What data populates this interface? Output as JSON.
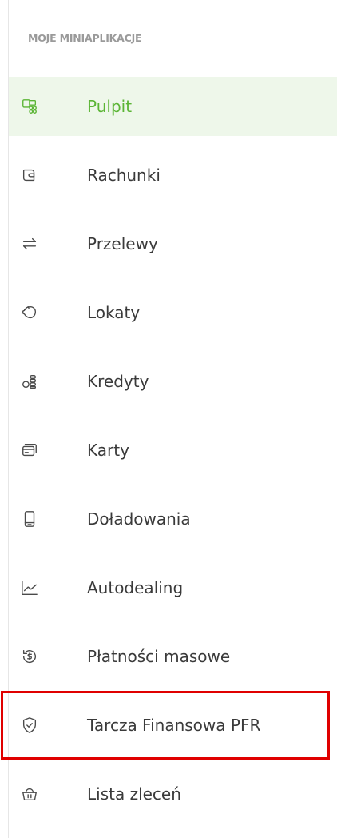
{
  "section_title": "MOJE MINIAPLIKACJE",
  "accent_color": "#5bb535",
  "highlight_color": "#e00000",
  "menu": [
    {
      "label": "Pulpit",
      "icon": "dashboard-icon",
      "active": true
    },
    {
      "label": "Rachunki",
      "icon": "wallet-icon",
      "active": false
    },
    {
      "label": "Przelewy",
      "icon": "transfer-arrows-icon",
      "active": false
    },
    {
      "label": "Lokaty",
      "icon": "piggy-bank-icon",
      "active": false
    },
    {
      "label": "Kredyty",
      "icon": "coins-icon",
      "active": false
    },
    {
      "label": "Karty",
      "icon": "cards-icon",
      "active": false
    },
    {
      "label": "Doładowania",
      "icon": "phone-icon",
      "active": false
    },
    {
      "label": "Autodealing",
      "icon": "line-chart-icon",
      "active": false
    },
    {
      "label": "Płatności masowe",
      "icon": "dollar-cycle-icon",
      "active": false
    },
    {
      "label": "Tarcza Finansowa PFR",
      "icon": "shield-check-icon",
      "active": false,
      "highlighted": true
    },
    {
      "label": "Lista zleceń",
      "icon": "basket-icon",
      "active": false
    }
  ]
}
